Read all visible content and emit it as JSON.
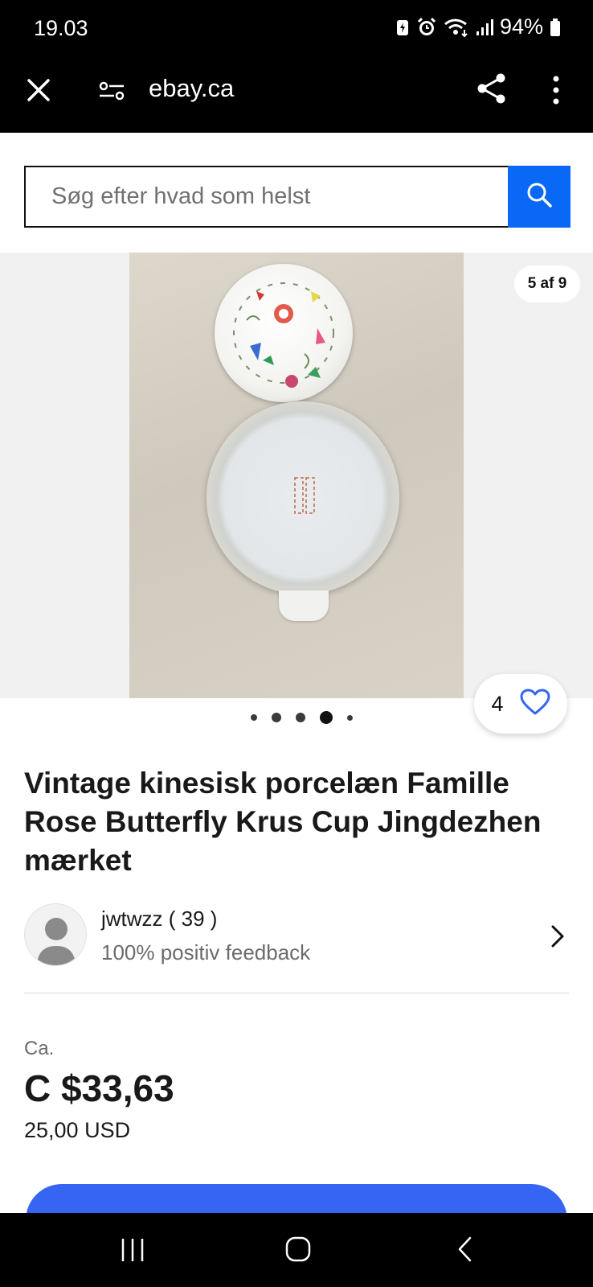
{
  "status_bar": {
    "time": "19.03",
    "battery": "94%",
    "icons": [
      "battery-saver-icon",
      "alarm-icon",
      "wifi-icon",
      "signal-icon",
      "battery-icon"
    ]
  },
  "browser": {
    "url": "ebay.ca",
    "icons": [
      "close-icon",
      "site-settings-icon",
      "share-icon",
      "more-icon"
    ]
  },
  "search": {
    "placeholder": "Søg efter hvad som helst",
    "button_icon": "search-icon"
  },
  "gallery": {
    "counter": "5 af 9",
    "watchers": "4",
    "dot_count": 5,
    "active_dot": 3
  },
  "listing": {
    "title": "Vintage kinesisk porcelæn Famille Rose Butterfly Krus Cup Jingdezhen mærket"
  },
  "seller": {
    "name": "jwtwzz ( 39 )",
    "feedback": "100% positiv feedback"
  },
  "price": {
    "approx_label": "Ca.",
    "amount": "C $33,63",
    "original": "25,00 USD"
  },
  "colors": {
    "search_button": "#0968f6",
    "primary_button": "#3665f3",
    "heart": "#3665f3"
  },
  "nav_bar": {
    "icons": [
      "recent-apps-icon",
      "home-icon",
      "back-icon"
    ]
  }
}
